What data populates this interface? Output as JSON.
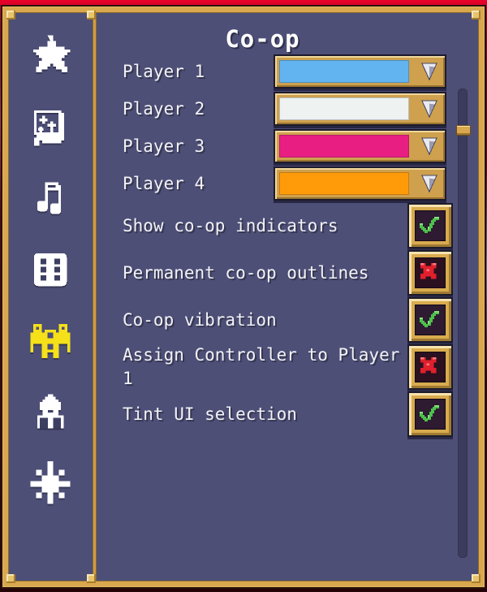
{
  "window": {
    "title": "Co-op"
  },
  "sidebar": {
    "items": [
      {
        "icon": "star-icon",
        "name": "sidebar-item-favorites",
        "active": false
      },
      {
        "icon": "card-sparkle-icon",
        "name": "sidebar-item-cards",
        "active": false
      },
      {
        "icon": "music-note-icon",
        "name": "sidebar-item-audio",
        "active": false
      },
      {
        "icon": "dice-icon",
        "name": "sidebar-item-gameplay",
        "active": false
      },
      {
        "icon": "people-group-icon",
        "name": "sidebar-item-coop",
        "active": true
      },
      {
        "icon": "temple-icon",
        "name": "sidebar-item-shrine",
        "active": false
      },
      {
        "icon": "snowflake-icon",
        "name": "sidebar-item-winter",
        "active": false
      }
    ]
  },
  "main": {
    "players": [
      {
        "label": "Player 1",
        "color": "#62b4f0",
        "control": "color-dropdown"
      },
      {
        "label": "Player 2",
        "color": "#eef3f1",
        "control": "color-dropdown"
      },
      {
        "label": "Player 3",
        "color": "#e81e82",
        "control": "color-dropdown"
      },
      {
        "label": "Player 4",
        "color": "#ff9a09",
        "control": "color-dropdown"
      }
    ],
    "toggles": [
      {
        "label": "Show co-op indicators",
        "state": "on",
        "mark": "check"
      },
      {
        "label": "Permanent co-op outlines",
        "state": "off",
        "mark": "cross"
      },
      {
        "label": "Co-op vibration",
        "state": "on",
        "mark": "check"
      },
      {
        "label": "Assign Controller to Player 1",
        "state": "off",
        "mark": "cross"
      },
      {
        "label": "Tint UI selection",
        "state": "on",
        "mark": "check"
      }
    ]
  },
  "scrollbar": {
    "name": "vertical-scrollbar",
    "position_pct": 8
  },
  "colors": {
    "panel_bg": "#4d4f77",
    "frame_gold": "#d9a84e",
    "text": "#f2f2f6",
    "accent_yellow": "#f5e019",
    "check_green": "#4cc24a",
    "cross_red": "#e0202c"
  }
}
